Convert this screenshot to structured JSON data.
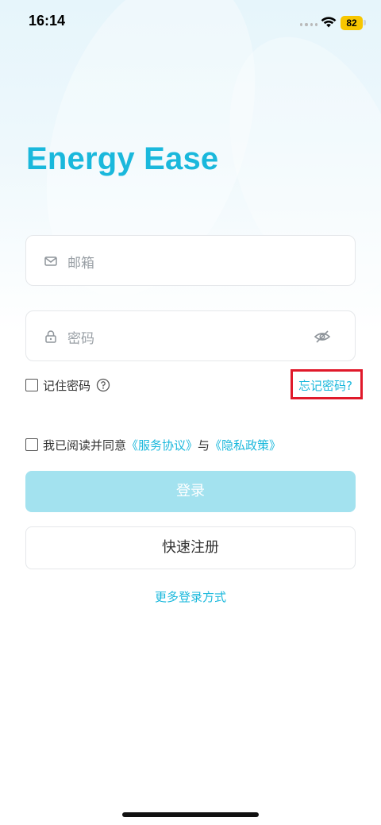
{
  "status_bar": {
    "time": "16:14",
    "battery_level": "82"
  },
  "app": {
    "title": "Energy Ease"
  },
  "form": {
    "email_placeholder": "邮箱",
    "password_placeholder": "密码",
    "remember_label": "记住密码",
    "forgot_label": "忘记密码?",
    "agree_prefix": "我已阅读并同意",
    "service_agreement": "《服务协议》",
    "agree_joiner": "与",
    "privacy_policy": "《隐私政策》",
    "login_label": "登录",
    "register_label": "快速注册",
    "more_login_label": "更多登录方式"
  },
  "colors": {
    "accent": "#1ab8dc",
    "login_button_disabled": "#a3e2ef",
    "highlight_box": "#e0192a"
  },
  "icons": [
    "mail-icon",
    "lock-icon",
    "eye-off-icon",
    "help-circle-icon",
    "wifi-icon",
    "battery-icon"
  ]
}
